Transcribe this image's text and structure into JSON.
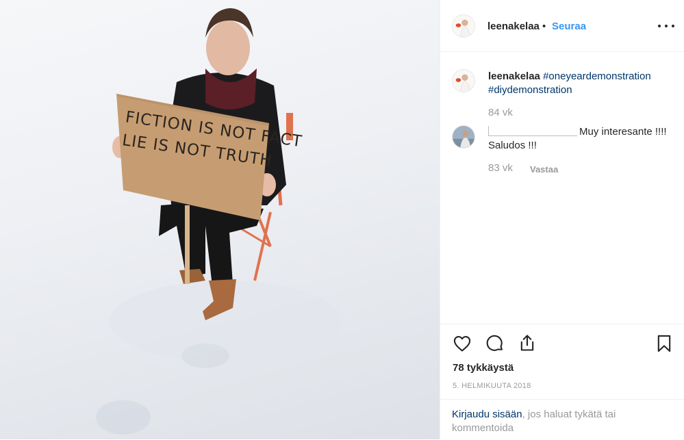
{
  "post": {
    "image": {
      "sign_line1": "FICTION IS NOT FACT",
      "sign_line2": "LIE IS NOT TRUTH"
    }
  },
  "header": {
    "username": "leenakelaa",
    "separator": "•",
    "follow_label": "Seuraa",
    "more_icon": "more-horizontal-icon"
  },
  "caption": {
    "username": "leenakelaa",
    "hashtag1": "#oneyeardemonstration",
    "hashtag2": "#diydemonstration",
    "age": "84 vk"
  },
  "comments": [
    {
      "text": "Muy interesante !!!! Saludos !!!",
      "age": "83 vk",
      "reply_label": "Vastaa"
    }
  ],
  "actions": {
    "like_icon": "heart-icon",
    "comment_icon": "comment-icon",
    "share_icon": "share-icon",
    "save_icon": "bookmark-icon",
    "likes_text": "78 tykkäystä",
    "date_text": "5. HELMIKUUTA 2018"
  },
  "login_prompt": {
    "link_text": "Kirjaudu sisään",
    "rest_text": ", jos haluat tykätä tai kommentoida"
  },
  "colors": {
    "link_blue": "#3897f0",
    "hashtag_navy": "#003569",
    "muted_gray": "#999999",
    "text": "#262626"
  }
}
